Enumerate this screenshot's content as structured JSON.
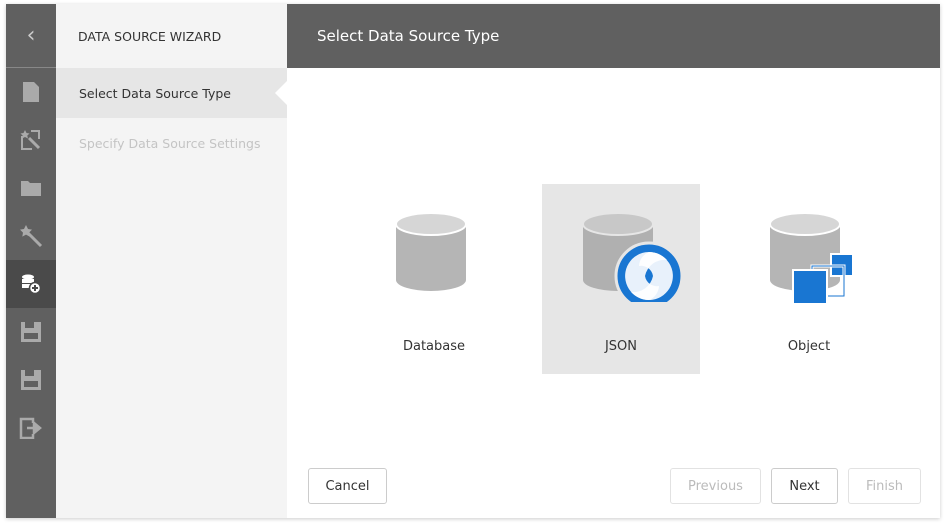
{
  "sidebar": {
    "icons": [
      "back-chevron-icon",
      "new-file-icon",
      "wizard-edit-icon",
      "open-folder-icon",
      "magic-wand-icon",
      "add-data-source-icon",
      "save-icon",
      "save-as-icon",
      "exit-icon"
    ],
    "active": "add-data-source-icon"
  },
  "wizard": {
    "title": "DATA SOURCE WIZARD",
    "steps": [
      {
        "label": "Select Data Source Type",
        "state": "active"
      },
      {
        "label": "Specify Data Source Settings",
        "state": "disabled"
      }
    ]
  },
  "main": {
    "header": "Select Data Source Type",
    "options": [
      {
        "label": "Database"
      },
      {
        "label": "JSON",
        "selected": true
      },
      {
        "label": "Object"
      }
    ]
  },
  "buttons": {
    "cancel": "Cancel",
    "previous": "Previous",
    "next": "Next",
    "finish": "Finish"
  },
  "colors": {
    "sidebar": "#606060",
    "accent": "#1976d2",
    "selected_tile": "#e6e6e6"
  }
}
